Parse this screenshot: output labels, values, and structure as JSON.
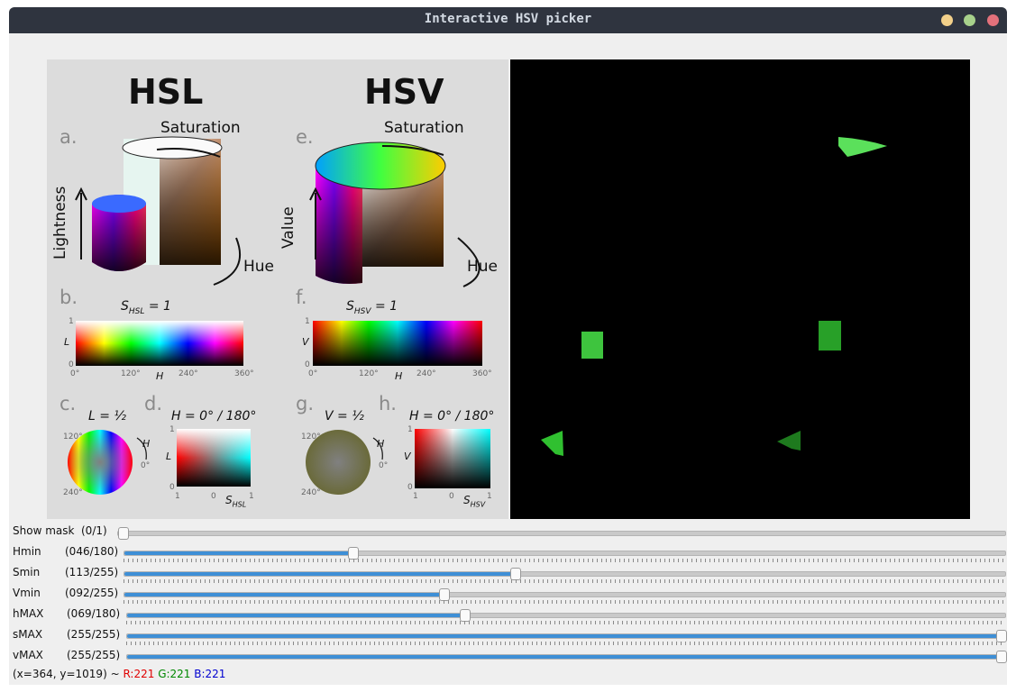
{
  "window": {
    "title": "Interactive HSV picker"
  },
  "figure": {
    "hsl_title": "HSL",
    "hsv_title": "HSV",
    "panel_letters": [
      "a.",
      "b.",
      "c.",
      "d.",
      "e.",
      "f.",
      "g.",
      "h."
    ],
    "saturation": "Saturation",
    "lightness": "Lightness",
    "value": "Value",
    "hue": "Hue",
    "s_hsl_eq": "S",
    "s_hsl_sub": "HSL",
    "s_hsv_sub": "HSV",
    "eq_one": " = 1",
    "axis_l": "L",
    "axis_v": "V",
    "axis_h": "H",
    "tick_0": "0",
    "tick_1": "1",
    "tick_0deg": "0°",
    "tick_120deg": "120°",
    "tick_240deg": "240°",
    "tick_360deg": "360°",
    "l_half": "L = ½",
    "v_half": "V = ½",
    "h_0_180": "H = 0° / 180°",
    "axis_s": "S"
  },
  "sliders": [
    {
      "name": "Show mask",
      "value": "(0/1)",
      "fraction": 0.0
    },
    {
      "name": "Hmin",
      "value": "(046/180)",
      "fraction": 0.256
    },
    {
      "name": "Smin",
      "value": "(113/255)",
      "fraction": 0.443
    },
    {
      "name": "Vmin",
      "value": "(092/255)",
      "fraction": 0.361
    },
    {
      "name": "hMAX",
      "value": "(069/180)",
      "fraction": 0.383
    },
    {
      "name": "sMAX",
      "value": "(255/255)",
      "fraction": 1.0
    },
    {
      "name": "vMAX",
      "value": "(255/255)",
      "fraction": 1.0
    }
  ],
  "status": {
    "coords": "(x=364, y=1019) ~ ",
    "r": "R:221",
    "g": "G:221",
    "b": "B:221"
  },
  "colors": {
    "titlebar": "#2f343f",
    "accent": "#3e8fd6"
  }
}
